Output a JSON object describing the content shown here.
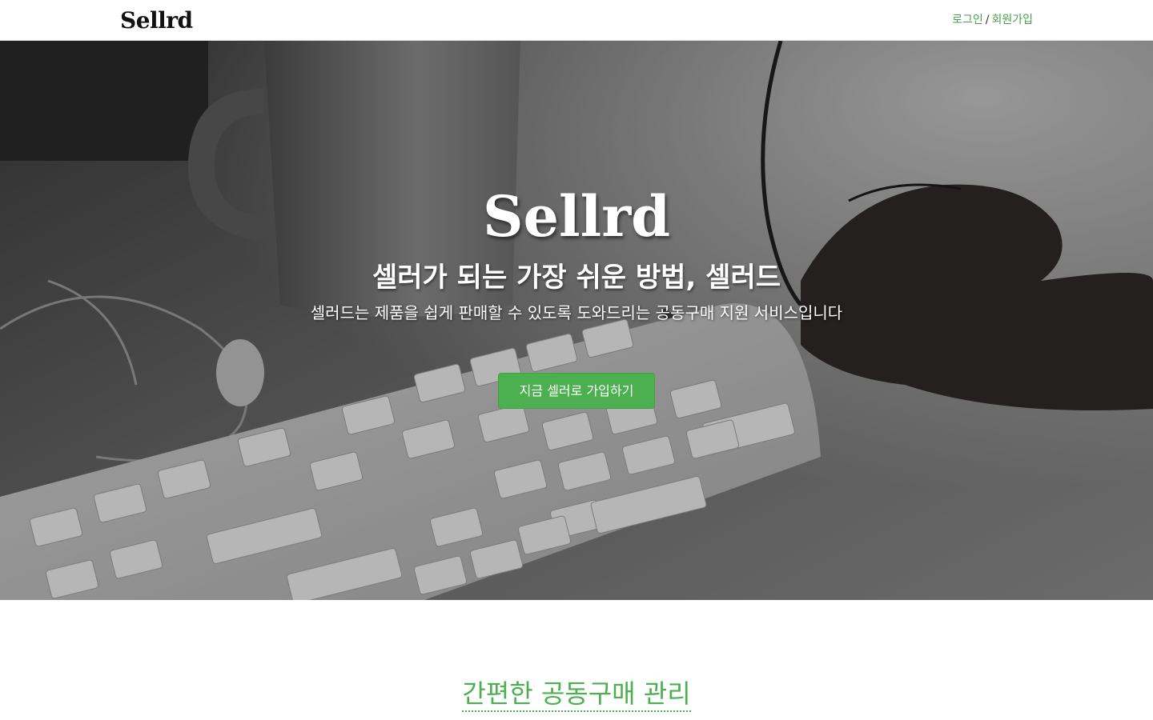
{
  "header": {
    "logo": "Sellrd",
    "login_label": "로그인",
    "separator": "/",
    "signup_label": "회원가입",
    "link_color": "#4a9e4a"
  },
  "hero": {
    "title": "Sellrd",
    "subtitle": "셀러가 되는 가장 쉬운 방법, 셀러드",
    "description": "셀러드는 제품을 쉽게 판매할 수 있도록 도와드리는 공동구매 지원 서비스입니다",
    "cta_label": "지금 셀러로 가입하기",
    "cta_color": "#4caf50",
    "background_image": "grayscale-desk-keyboard-mug-mouse"
  },
  "section": {
    "title": "간편한 공동구매 관리",
    "accent_color": "#4caf50"
  }
}
